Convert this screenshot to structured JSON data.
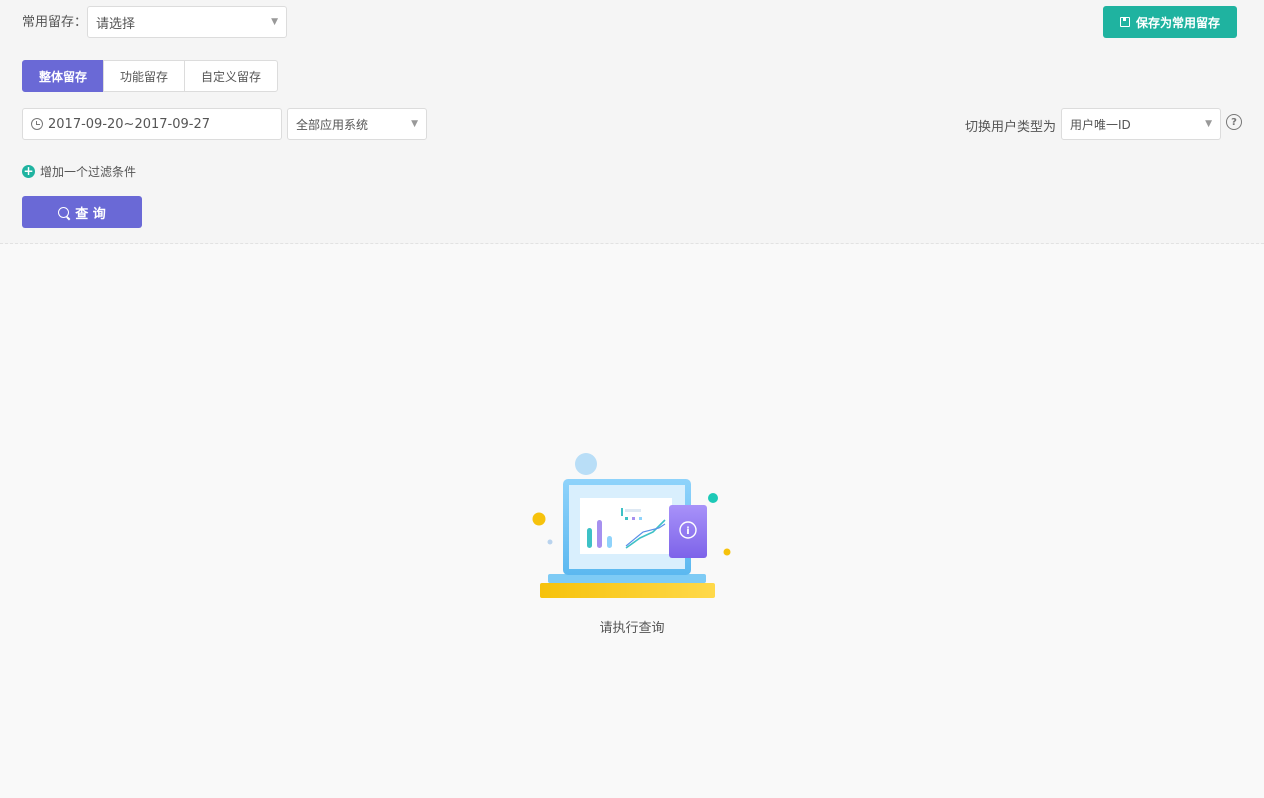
{
  "filters": {
    "saved_label": "常用留存：",
    "saved_select_value": "请选择",
    "save_button_label": "保存为常用留存"
  },
  "tabs": [
    {
      "label": "整体留存",
      "active": true
    },
    {
      "label": "功能留存",
      "active": false
    },
    {
      "label": "自定义留存",
      "active": false
    }
  ],
  "date_range": "2017-09-20~2017-09-27",
  "system_select_value": "全部应用系统",
  "user_type": {
    "label": "切换用户类型为",
    "value": "用户唯一ID",
    "help_icon": "?"
  },
  "add_filter_label": "增加一个过滤条件",
  "add_filter_icon": "+",
  "query_button_label": "查 询",
  "empty_state": {
    "message": "请执行查询",
    "info_glyph": "i"
  },
  "colors": {
    "primary": "#6a69d6",
    "accent": "#1fb3a0"
  }
}
